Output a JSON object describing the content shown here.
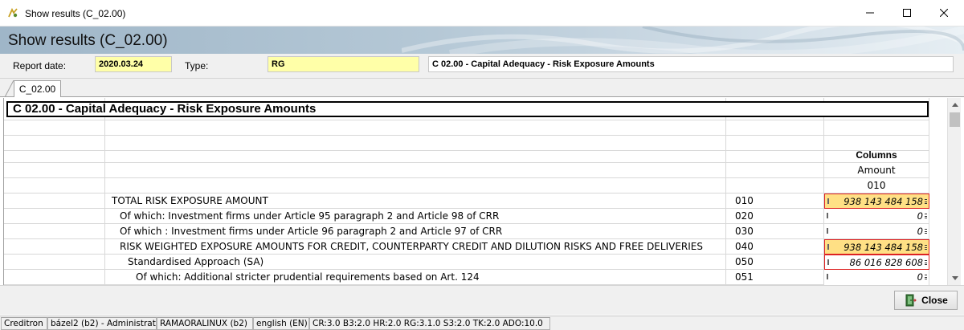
{
  "window": {
    "title": "Show results (C_02.00)",
    "icon": "app-icon",
    "controls": [
      "minimize",
      "maximize",
      "close"
    ]
  },
  "banner": {
    "title": "Show results (C_02.00)"
  },
  "header": {
    "report_date_label": "Report date:",
    "report_date_value": "2020.03.24",
    "type_label": "Type:",
    "type_value": "RG",
    "description_value": "C 02.00 - Capital Adequacy - Risk Exposure Amounts"
  },
  "tabs": [
    {
      "label": "C_02.00",
      "active": true
    }
  ],
  "report": {
    "title": "C 02.00 - Capital Adequacy - Risk Exposure Amounts",
    "columns_heading": "Columns",
    "column_name": "Amount",
    "column_code": "010",
    "rows": [
      {
        "label": "TOTAL RISK EXPOSURE AMOUNT",
        "code": "010",
        "amount": "938 143 484 158",
        "style": "highlight"
      },
      {
        "label": "Of which: Investment firms under Article 95 paragraph 2 and Article 98 of CRR",
        "code": "020",
        "amount": "0",
        "style": "plain"
      },
      {
        "label": "Of which : Investment firms under Article 96 paragraph 2 and Article 97 of CRR",
        "code": "030",
        "amount": "0",
        "style": "plain"
      },
      {
        "label": "RISK WEIGHTED EXPOSURE AMOUNTS FOR CREDIT, COUNTERPARTY CREDIT AND DILUTION RISKS AND FREE DELIVERIES",
        "code": "040",
        "amount": "938 143 484 158",
        "style": "highlight"
      },
      {
        "label": "Standardised Approach (SA)",
        "code": "050",
        "amount": "86 016 828 608",
        "style": "red-border"
      },
      {
        "label": "Of which: Additional stricter prudential requirements based on Art. 124",
        "code": "051",
        "amount": "0",
        "style": "plain"
      }
    ]
  },
  "footer": {
    "close_label": "Close"
  },
  "statusbar": {
    "items": [
      "Creditron",
      "bázel2 (b2) - Administrat",
      "RAMAORALINUX (b2)",
      "english (EN)",
      "CR:3.0  B3:2.0  HR:2.0  RG:3.1.0  S3:2.0  TK:2.0  ADO:10.0"
    ]
  },
  "colors": {
    "highlight_fill": "#ffe085",
    "highlight_border": "#dd2222",
    "field_yellow": "#ffffa8",
    "banner": "#b5c8d6"
  }
}
